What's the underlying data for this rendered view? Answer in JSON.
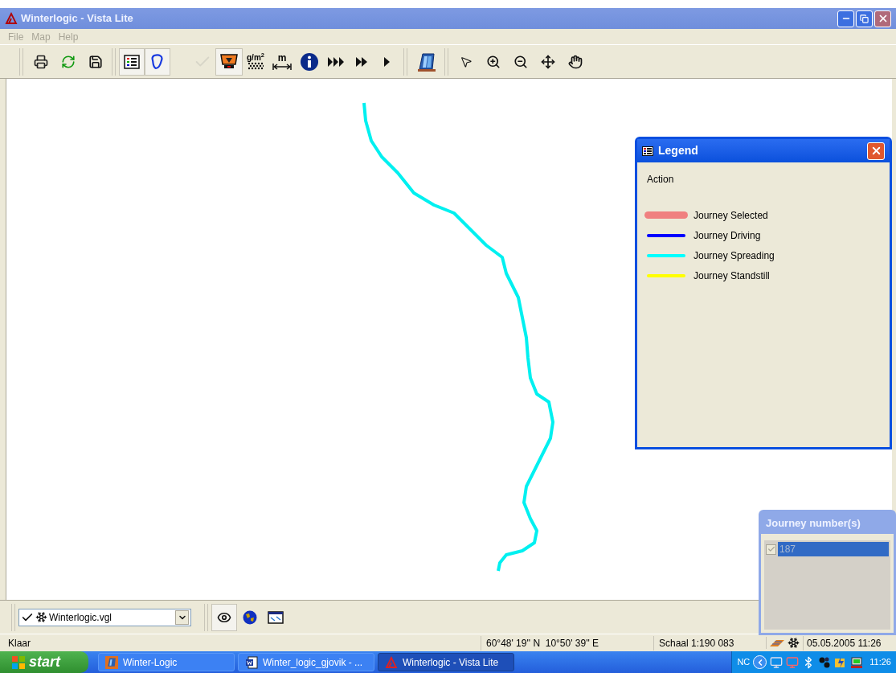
{
  "window": {
    "title": "Winterlogic - Vista Lite"
  },
  "menu": [
    {
      "label": "File",
      "disabled": true
    },
    {
      "label": "Map",
      "disabled": true
    },
    {
      "label": "Help",
      "disabled": true
    }
  ],
  "toolbar": [
    [
      {
        "kind": "print",
        "pressed": false,
        "disabled": false
      },
      {
        "kind": "refresh",
        "pressed": false,
        "disabled": false
      },
      {
        "kind": "save",
        "pressed": false,
        "disabled": false
      }
    ],
    [
      {
        "kind": "list",
        "pressed": true,
        "disabled": false
      },
      {
        "kind": "outline",
        "pressed": true,
        "disabled": false
      },
      {
        "kind": "check",
        "pressed": false,
        "disabled": true
      },
      {
        "kind": "spreader",
        "pressed": true,
        "disabled": false
      },
      {
        "kind": "density",
        "label": "g/m$^{2}$",
        "pressed": false,
        "disabled": false
      },
      {
        "kind": "measure",
        "label": "m",
        "pressed": false,
        "disabled": false
      },
      {
        "kind": "info",
        "pressed": false,
        "disabled": false
      },
      {
        "kind": "fast3",
        "pressed": false,
        "disabled": false
      },
      {
        "kind": "fast2",
        "pressed": false,
        "disabled": false
      },
      {
        "kind": "play",
        "pressed": false,
        "disabled": false
      }
    ],
    [
      {
        "kind": "book",
        "pressed": false,
        "disabled": false
      }
    ],
    [
      {
        "kind": "pointer",
        "pressed": false,
        "disabled": false
      },
      {
        "kind": "zoomin",
        "pressed": false,
        "disabled": false
      },
      {
        "kind": "zoomout",
        "pressed": false,
        "disabled": false
      },
      {
        "kind": "move",
        "pressed": false,
        "disabled": false
      },
      {
        "kind": "hand",
        "pressed": false,
        "disabled": false
      }
    ]
  ],
  "legend": {
    "title": "Legend",
    "heading": "Action",
    "items": [
      {
        "label": "Journey Selected",
        "color": "#f08080",
        "kind": "wide"
      },
      {
        "label": "Journey Driving",
        "color": "#0000ff",
        "kind": "line"
      },
      {
        "label": "Journey Spreading",
        "color": "#00ffff",
        "kind": "line"
      },
      {
        "label": "Journey Standstill",
        "color": "#ffff00",
        "kind": "line"
      }
    ]
  },
  "journeys": {
    "title": "Journey number(s)",
    "items": [
      {
        "label": "187",
        "checked": true,
        "selected": true
      }
    ]
  },
  "layer_select": {
    "value": "Winterlogic.vgl"
  },
  "bottom_tools": [
    {
      "kind": "eye",
      "pressed": true
    },
    {
      "kind": "globe",
      "pressed": false
    },
    {
      "kind": "window",
      "pressed": false
    }
  ],
  "status_bar": {
    "message": "Klaar",
    "coordinates": "60°48' 19'' N  10°50' 39'' E",
    "scale": "Schaal 1:190 083",
    "datetime": "05.05.2005 11:26"
  },
  "taskbar": {
    "start": "start",
    "tasks": [
      {
        "label": "Winter-Logic",
        "kind": "book",
        "selected": false
      },
      {
        "label": "Winter_logic_gjovik - ...",
        "kind": "word",
        "selected": false
      },
      {
        "label": "Winterlogic - Vista Lite",
        "kind": "app",
        "selected": true
      }
    ],
    "tray_label": "NC",
    "clock": "11:26"
  }
}
